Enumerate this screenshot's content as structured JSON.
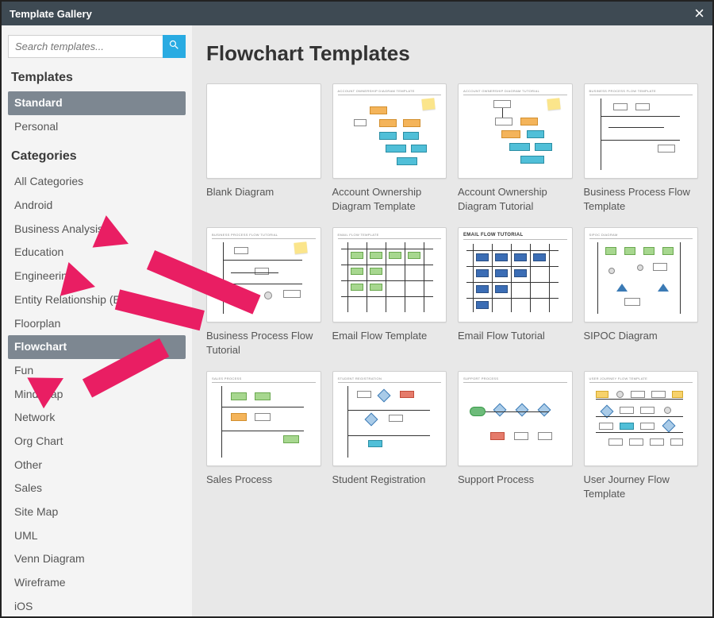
{
  "header": {
    "title": "Template Gallery"
  },
  "search": {
    "placeholder": "Search templates..."
  },
  "sections": {
    "templates_title": "Templates",
    "categories_title": "Categories"
  },
  "templates_list": {
    "items": [
      {
        "label": "Standard",
        "selected": true
      },
      {
        "label": "Personal",
        "selected": false
      }
    ]
  },
  "categories_list": {
    "items": [
      {
        "label": "All Categories",
        "selected": false
      },
      {
        "label": "Android",
        "selected": false
      },
      {
        "label": "Business Analysis",
        "selected": false
      },
      {
        "label": "Education",
        "selected": false
      },
      {
        "label": "Engineering",
        "selected": false
      },
      {
        "label": "Entity Relationship (ERD)",
        "selected": false
      },
      {
        "label": "Floorplan",
        "selected": false
      },
      {
        "label": "Flowchart",
        "selected": true
      },
      {
        "label": "Fun",
        "selected": false
      },
      {
        "label": "Mind Map",
        "selected": false
      },
      {
        "label": "Network",
        "selected": false
      },
      {
        "label": "Org Chart",
        "selected": false
      },
      {
        "label": "Other",
        "selected": false
      },
      {
        "label": "Sales",
        "selected": false
      },
      {
        "label": "Site Map",
        "selected": false
      },
      {
        "label": "UML",
        "selected": false
      },
      {
        "label": "Venn Diagram",
        "selected": false
      },
      {
        "label": "Wireframe",
        "selected": false
      },
      {
        "label": "iOS",
        "selected": false
      }
    ]
  },
  "main": {
    "title": "Flowchart Templates",
    "cards": [
      {
        "label": "Blank Diagram",
        "thumb_title": ""
      },
      {
        "label": "Account Ownership Diagram Template",
        "thumb_title": "ACCOUNT OWNERSHIP DIAGRAM TEMPLATE"
      },
      {
        "label": "Account Ownership Diagram Tutorial",
        "thumb_title": "ACCOUNT OWNERSHIP DIAGRAM TUTORIAL"
      },
      {
        "label": "Business Process Flow Template",
        "thumb_title": "BUSINESS PROCESS FLOW TEMPLATE"
      },
      {
        "label": "Business Process Flow Tutorial",
        "thumb_title": "BUSINESS PROCESS FLOW TUTORIAL"
      },
      {
        "label": "Email Flow Template",
        "thumb_title": "EMAIL FLOW TEMPLATE"
      },
      {
        "label": "Email Flow Tutorial",
        "thumb_title": "Email Flow Tutorial"
      },
      {
        "label": "SIPOC Diagram",
        "thumb_title": "SIPOC DIAGRAM"
      },
      {
        "label": "Sales Process",
        "thumb_title": "SALES PROCESS"
      },
      {
        "label": "Student Registration",
        "thumb_title": "STUDENT REGISTRATION"
      },
      {
        "label": "Support Process",
        "thumb_title": "SUPPORT PROCESS"
      },
      {
        "label": "User Journey Flow Template",
        "thumb_title": "USER JOURNEY FLOW TEMPLATE"
      }
    ]
  }
}
